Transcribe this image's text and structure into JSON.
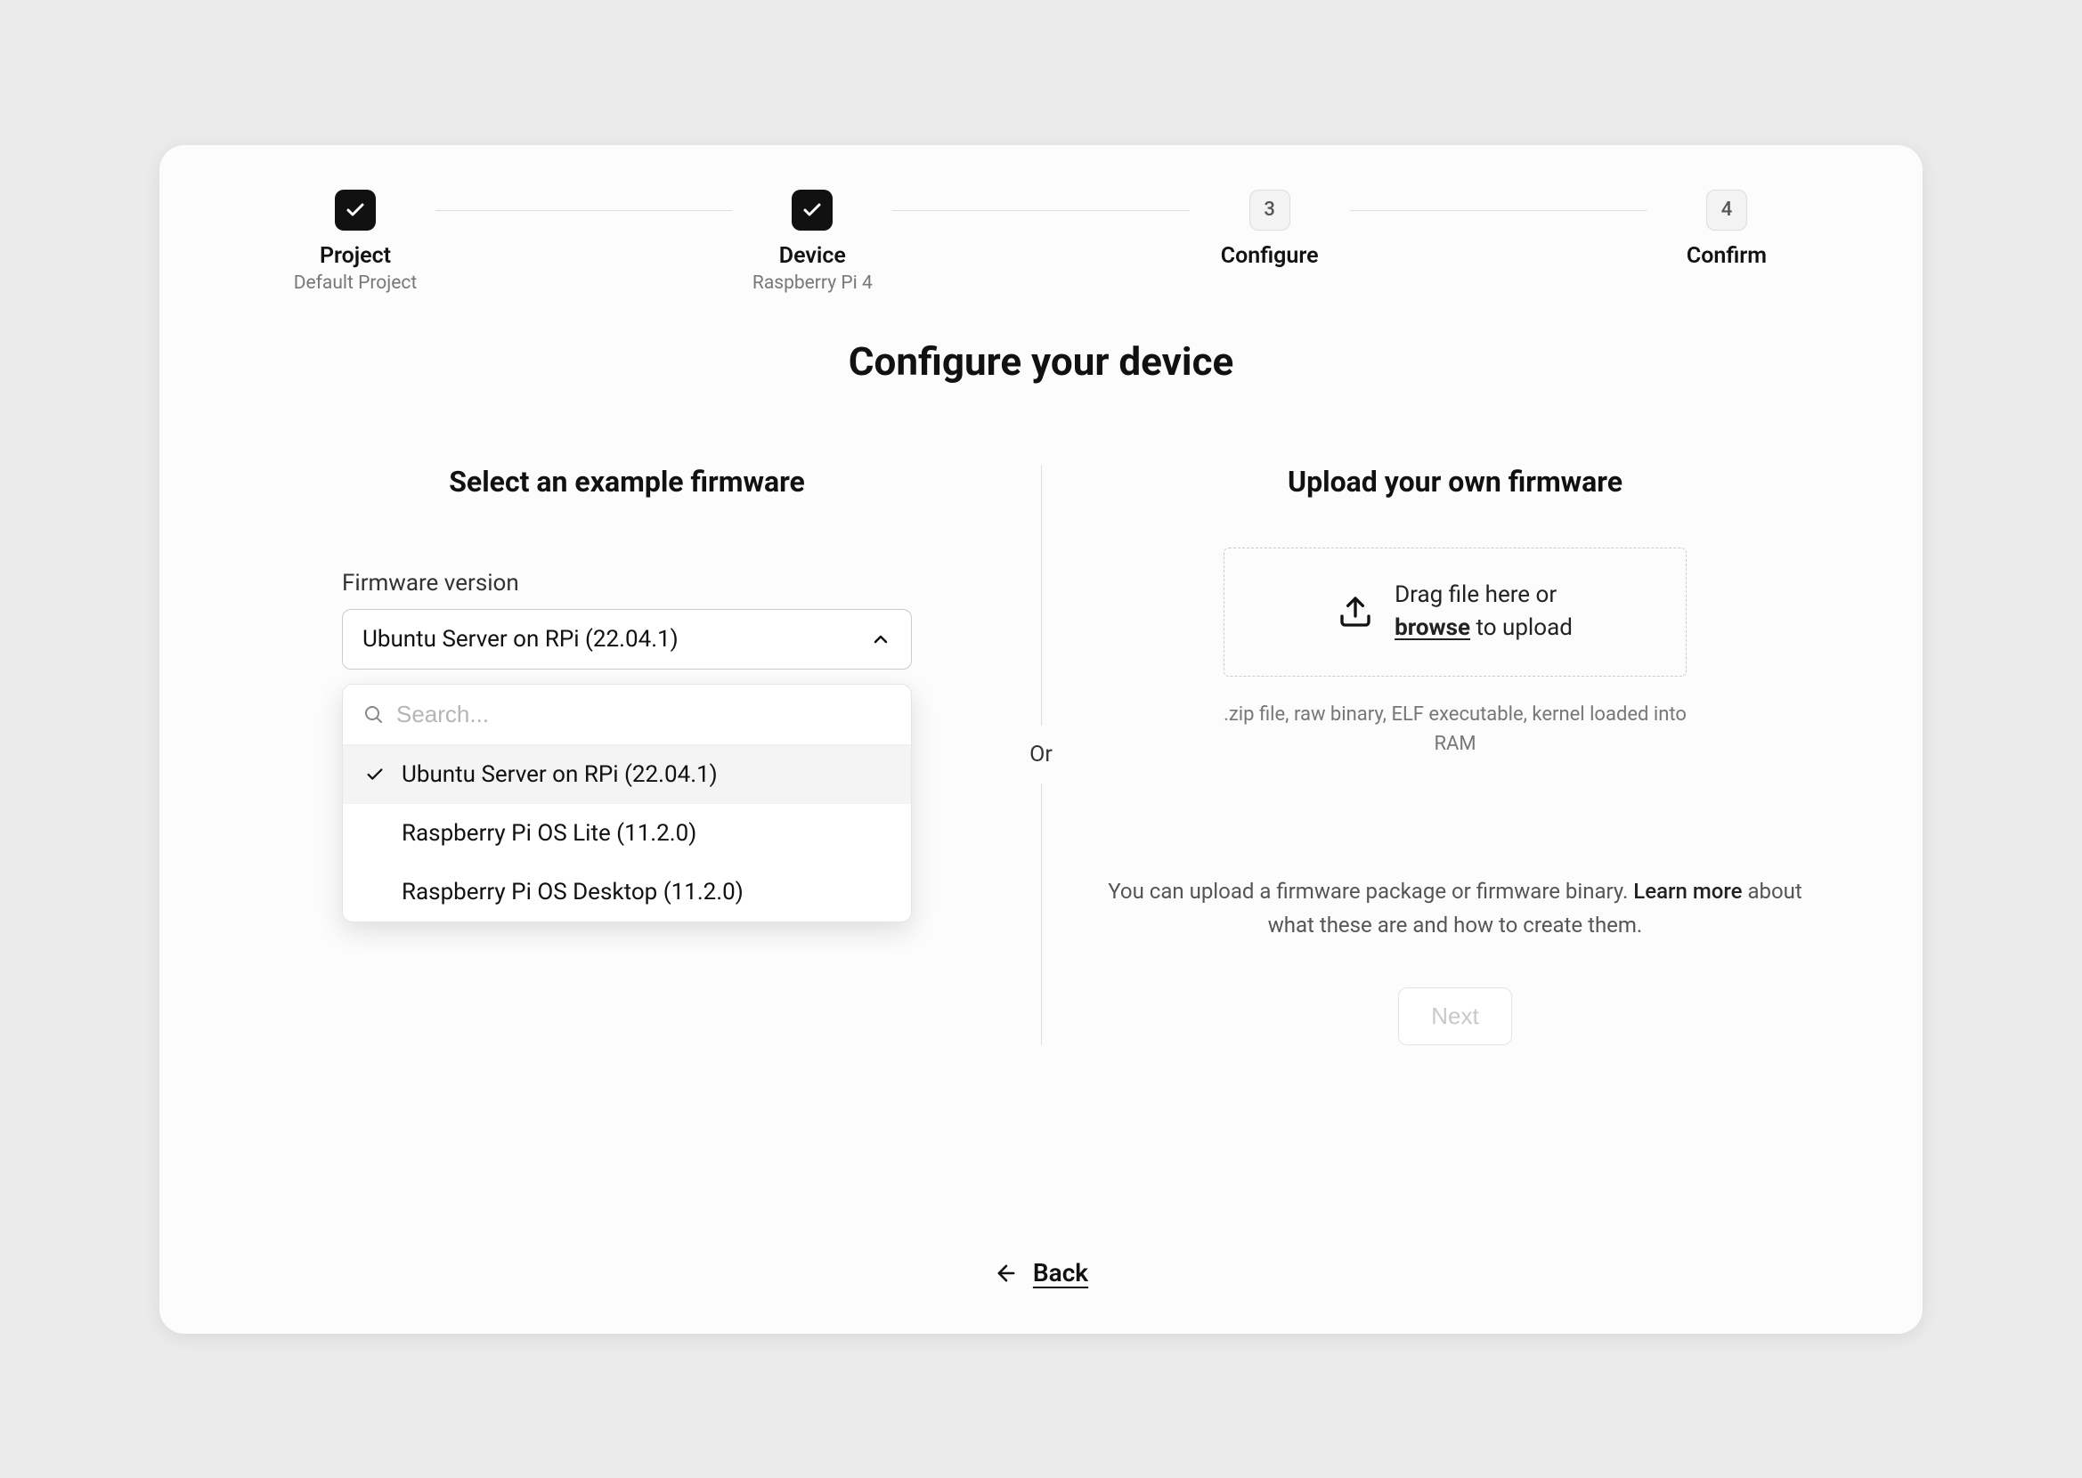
{
  "stepper": {
    "steps": [
      {
        "label": "Project",
        "sub": "Default Project",
        "state": "done"
      },
      {
        "label": "Device",
        "sub": "Raspberry Pi 4",
        "state": "done"
      },
      {
        "label": "Configure",
        "sub": "",
        "state": "current",
        "number": "3"
      },
      {
        "label": "Confirm",
        "sub": "",
        "state": "pending",
        "number": "4"
      }
    ]
  },
  "page_title": "Configure your device",
  "left": {
    "heading": "Select an example firmware",
    "field_label": "Firmware version",
    "selected_value": "Ubuntu Server on RPi (22.04.1)",
    "search_placeholder": "Search...",
    "options": [
      {
        "label": "Ubuntu Server on RPi (22.04.1)",
        "selected": true
      },
      {
        "label": "Raspberry Pi OS Lite (11.2.0)",
        "selected": false
      },
      {
        "label": "Raspberry Pi OS Desktop (11.2.0)",
        "selected": false
      }
    ]
  },
  "divider_text": "Or",
  "right": {
    "heading": "Upload your own firmware",
    "drop_line1": "Drag file here or",
    "drop_browse": "browse",
    "drop_line2_suffix": " to upload",
    "hint": ".zip file, raw binary, ELF executable, kernel loaded into RAM",
    "info_prefix": "You can upload a firmware package or firmware binary. ",
    "learn_more": "Learn more",
    "info_suffix": " about what these are and how to create them.",
    "next_label": "Next"
  },
  "back_label": "Back"
}
